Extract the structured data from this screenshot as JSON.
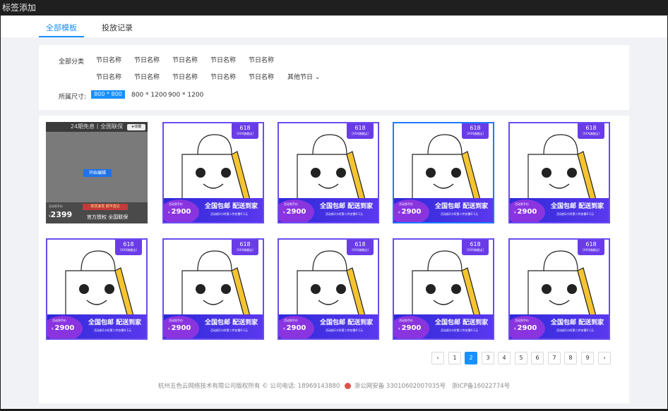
{
  "window": {
    "title": "标签添加"
  },
  "tabs": [
    {
      "label": "全部模板",
      "active": true
    },
    {
      "label": "投放记录",
      "active": false
    }
  ],
  "filters": {
    "category_label": "全部分类",
    "categories_row1": [
      "节日名称",
      "节日名称",
      "节日名称",
      "节日名称",
      "节日名称"
    ],
    "categories_row2": [
      "节日名称",
      "节日名称",
      "节日名称",
      "节日名称",
      "节日名称"
    ],
    "more_label": "其他节日",
    "size_label": "所属尺寸:",
    "sizes": [
      "800 * 800",
      "800 * 1200",
      "900 * 1200"
    ],
    "selected_size": "800 * 800"
  },
  "template_card": {
    "badge_title": "618",
    "badge_sub": "[XXX旗舰店]",
    "price_label": "活动到手价",
    "currency": "¥",
    "price": "2900",
    "headline": "全国包邮 配送到家",
    "subline": "活动前2小时第二件仅需0.1元"
  },
  "hover_card": {
    "top_text": "24期免息丨全国联保",
    "fav_label": "收藏",
    "button_label": "开始编辑",
    "strip_text": "现货速发 顺丰直达",
    "price_label": "活动到手价",
    "currency": "¥",
    "price": "2399",
    "footer_text": "官方授权 全国联保"
  },
  "pagination": {
    "pages": [
      "1",
      "2",
      "3",
      "4",
      "5",
      "6",
      "7",
      "8",
      "9"
    ],
    "current": "2",
    "prev_icon": "chevron-left-icon",
    "next_icon": "chevron-right-icon"
  },
  "footer": {
    "company": "杭州五色云网络技术有限公司版权所有 © 公司电话:  18969143880",
    "police": "浙公网安备 33010602007035号",
    "icp": "浙ICP备16022774号"
  },
  "colors": {
    "accent": "#1890ff",
    "card_border": "#6a4cf0",
    "selected_border": "#1f78ff"
  }
}
